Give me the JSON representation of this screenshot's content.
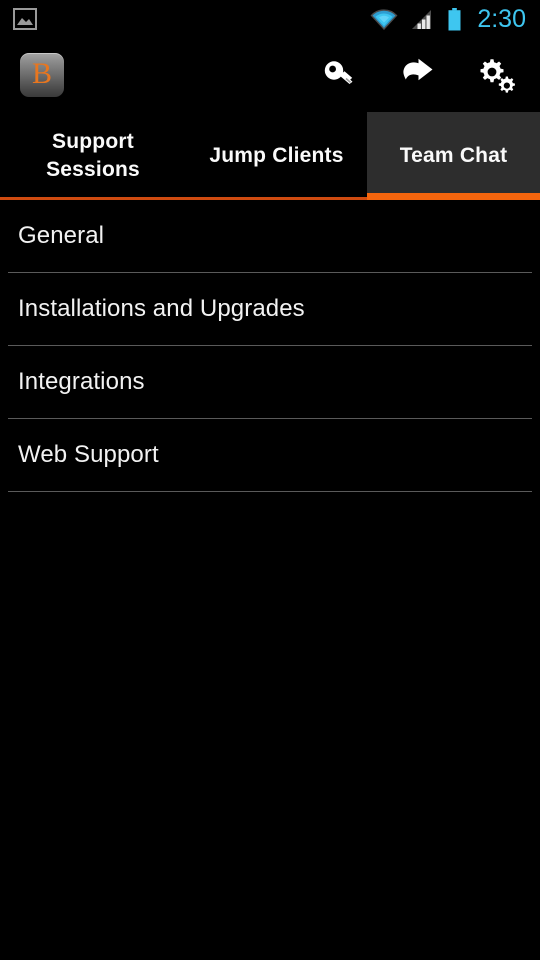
{
  "status_bar": {
    "notification_icon": "gallery-icon",
    "wifi_icon": "wifi-icon",
    "signal_icon": "signal-bars-icon",
    "battery_icon": "battery-icon",
    "time": "2:30",
    "accent_color": "#3ec6f0"
  },
  "action_bar": {
    "app_logo_letter": "B",
    "actions": [
      {
        "name": "key-icon",
        "label": "Key"
      },
      {
        "name": "jump-arrow-icon",
        "label": "Jump"
      },
      {
        "name": "gears-icon",
        "label": "Settings"
      }
    ]
  },
  "tabs": {
    "selected_index": 2,
    "selected_bg": "#2d2d2d",
    "indicator_color": "#f4650d",
    "indicator_inactive_color": "#cf4b10",
    "items": [
      {
        "label": "Support\nSessions",
        "line1": "Support",
        "line2": "Sessions"
      },
      {
        "label": "Jump Clients"
      },
      {
        "label": "Team Chat"
      }
    ]
  },
  "list": {
    "items": [
      {
        "label": "General"
      },
      {
        "label": "Installations and Upgrades"
      },
      {
        "label": "Integrations"
      },
      {
        "label": "Web Support"
      }
    ]
  },
  "theme": {
    "background": "#000000",
    "text_primary": "#f2f2f2",
    "divider": "#5a5a5a",
    "brand_orange": "#e8761f"
  }
}
